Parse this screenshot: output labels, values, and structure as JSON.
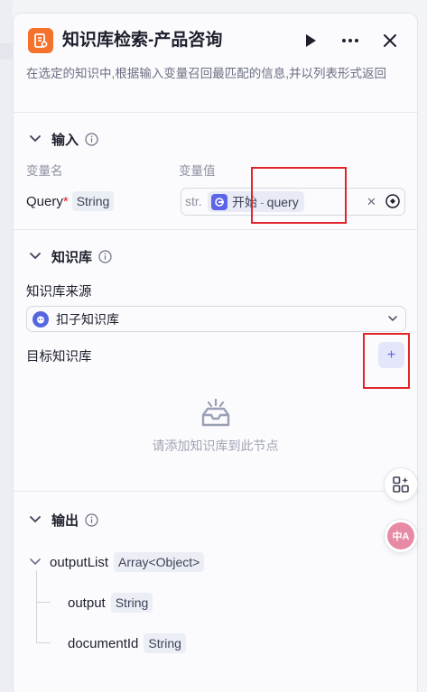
{
  "header": {
    "title": "知识库检索-产品咨询",
    "description": "在选定的知识中,根据输入变量召回最匹配的信息,并以列表形式返回"
  },
  "input_section": {
    "title": "输入",
    "col_name": "变量名",
    "col_value": "变量值",
    "var_name": "Query",
    "required_mark": "*",
    "var_type": "String",
    "value_prefix": "str.",
    "ref_source": "开始",
    "ref_sep": "-",
    "ref_var": "query"
  },
  "kb_section": {
    "title": "知识库",
    "source_label": "知识库来源",
    "source_value": "扣子知识库",
    "target_label": "目标知识库",
    "add_label": "+",
    "empty_text": "请添加知识库到此节点"
  },
  "output_section": {
    "title": "输出",
    "root": {
      "name": "outputList",
      "type": "Array<Object>"
    },
    "children": [
      {
        "name": "output",
        "type": "String"
      },
      {
        "name": "documentId",
        "type": "String"
      }
    ]
  },
  "float_buttons": {
    "translate_label": "中A"
  },
  "colors": {
    "accent": "#5c64e8",
    "logo": "#f5722d",
    "highlight": "#e0252b",
    "translate": "#e78aa5"
  }
}
